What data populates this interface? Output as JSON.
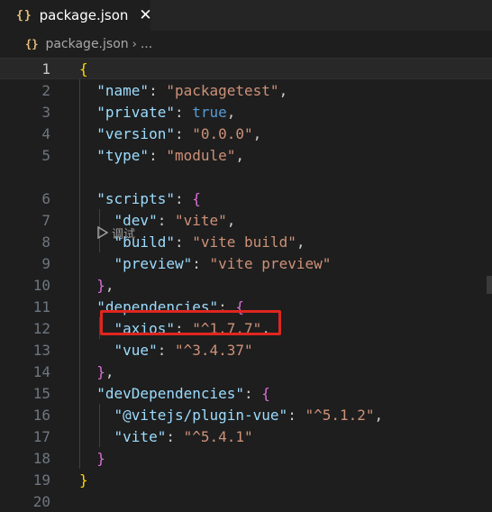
{
  "tab": {
    "icon": "{}",
    "label": "package.json",
    "close": "✕"
  },
  "breadcrumb": {
    "icon": "{}",
    "file": "package.json",
    "sep": "›",
    "more": "..."
  },
  "codelens": {
    "label": "调试"
  },
  "lines": [
    {
      "num": "1",
      "tokens": [
        {
          "t": "{",
          "c": "br1"
        }
      ]
    },
    {
      "num": "2",
      "tokens": [
        {
          "t": "  \"name\"",
          "c": "k"
        },
        {
          "t": ": ",
          "c": "p"
        },
        {
          "t": "\"packagetest\"",
          "c": "s"
        },
        {
          "t": ",",
          "c": "p"
        }
      ]
    },
    {
      "num": "3",
      "tokens": [
        {
          "t": "  \"private\"",
          "c": "k"
        },
        {
          "t": ": ",
          "c": "p"
        },
        {
          "t": "true",
          "c": "b"
        },
        {
          "t": ",",
          "c": "p"
        }
      ]
    },
    {
      "num": "4",
      "tokens": [
        {
          "t": "  \"version\"",
          "c": "k"
        },
        {
          "t": ": ",
          "c": "p"
        },
        {
          "t": "\"0.0.0\"",
          "c": "s"
        },
        {
          "t": ",",
          "c": "p"
        }
      ]
    },
    {
      "num": "5",
      "tokens": [
        {
          "t": "  \"type\"",
          "c": "k"
        },
        {
          "t": ": ",
          "c": "p"
        },
        {
          "t": "\"module\"",
          "c": "s"
        },
        {
          "t": ",",
          "c": "p"
        }
      ]
    },
    {
      "num": "6",
      "tokens": [
        {
          "t": "  \"scripts\"",
          "c": "k"
        },
        {
          "t": ": ",
          "c": "p"
        },
        {
          "t": "{",
          "c": "br2"
        }
      ]
    },
    {
      "num": "7",
      "tokens": [
        {
          "t": "    \"dev\"",
          "c": "k"
        },
        {
          "t": ": ",
          "c": "p"
        },
        {
          "t": "\"vite\"",
          "c": "s"
        },
        {
          "t": ",",
          "c": "p"
        }
      ]
    },
    {
      "num": "8",
      "tokens": [
        {
          "t": "    \"build\"",
          "c": "k"
        },
        {
          "t": ": ",
          "c": "p"
        },
        {
          "t": "\"vite build\"",
          "c": "s"
        },
        {
          "t": ",",
          "c": "p"
        }
      ]
    },
    {
      "num": "9",
      "tokens": [
        {
          "t": "    \"preview\"",
          "c": "k"
        },
        {
          "t": ": ",
          "c": "p"
        },
        {
          "t": "\"vite preview\"",
          "c": "s"
        }
      ]
    },
    {
      "num": "10",
      "tokens": [
        {
          "t": "  ",
          "c": "p"
        },
        {
          "t": "}",
          "c": "br2"
        },
        {
          "t": ",",
          "c": "p"
        }
      ]
    },
    {
      "num": "11",
      "tokens": [
        {
          "t": "  \"dependencies\"",
          "c": "k"
        },
        {
          "t": ": ",
          "c": "p"
        },
        {
          "t": "{",
          "c": "br2"
        }
      ]
    },
    {
      "num": "12",
      "tokens": [
        {
          "t": "    \"axios\"",
          "c": "k"
        },
        {
          "t": ": ",
          "c": "p"
        },
        {
          "t": "\"^1.7.7\"",
          "c": "s"
        },
        {
          "t": ",",
          "c": "p"
        }
      ]
    },
    {
      "num": "13",
      "tokens": [
        {
          "t": "    \"vue\"",
          "c": "k"
        },
        {
          "t": ": ",
          "c": "p"
        },
        {
          "t": "\"^3.4.37\"",
          "c": "s"
        }
      ]
    },
    {
      "num": "14",
      "tokens": [
        {
          "t": "  ",
          "c": "p"
        },
        {
          "t": "}",
          "c": "br2"
        },
        {
          "t": ",",
          "c": "p"
        }
      ]
    },
    {
      "num": "15",
      "tokens": [
        {
          "t": "  \"devDependencies\"",
          "c": "k"
        },
        {
          "t": ": ",
          "c": "p"
        },
        {
          "t": "{",
          "c": "br2"
        }
      ]
    },
    {
      "num": "16",
      "tokens": [
        {
          "t": "    \"@vitejs/plugin-vue\"",
          "c": "k"
        },
        {
          "t": ": ",
          "c": "p"
        },
        {
          "t": "\"^5.1.2\"",
          "c": "s"
        },
        {
          "t": ",",
          "c": "p"
        }
      ]
    },
    {
      "num": "17",
      "tokens": [
        {
          "t": "    \"vite\"",
          "c": "k"
        },
        {
          "t": ": ",
          "c": "p"
        },
        {
          "t": "\"^5.4.1\"",
          "c": "s"
        }
      ]
    },
    {
      "num": "18",
      "tokens": [
        {
          "t": "  ",
          "c": "p"
        },
        {
          "t": "}",
          "c": "br2"
        }
      ]
    },
    {
      "num": "19",
      "tokens": [
        {
          "t": "}",
          "c": "br1"
        }
      ]
    },
    {
      "num": "20",
      "tokens": []
    }
  ],
  "colors": {
    "editor_bg": "#1e1e1e",
    "key": "#9cdcfe",
    "string": "#ce9178",
    "boolean": "#569cd6",
    "highlight_box": "#e0261f"
  }
}
